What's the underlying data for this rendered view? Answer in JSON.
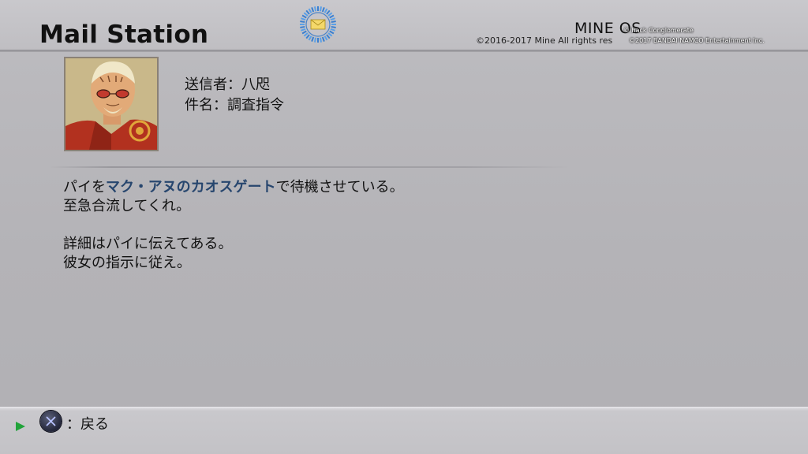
{
  "header": {
    "title": "Mail Station",
    "os_name": "MINE OS",
    "copyright_mine": "©2016-2017 Mine All rights res",
    "copyright_hack": "©.hack Conglomerate",
    "copyright_bandai": "©2017 BANDAI NAMCO Entertainment Inc.",
    "emblem_icon": "mail-envelope-icon"
  },
  "message": {
    "avatar_icon": "sender-portrait",
    "sender_label": "送信者",
    "sender_separator": "：",
    "sender_name": "八咫",
    "subject_label": "件名",
    "subject_separator": "：",
    "subject_text": "調査指令",
    "body": {
      "line1_pre": "パイを",
      "line1_highlight": "マク・アヌのカオスゲート",
      "line1_post": "で待機させている。",
      "line2": "至急合流してくれ。",
      "line3": "詳細はパイに伝えてある。",
      "line4": "彼女の指示に従え。"
    },
    "highlight_color": "#27466e"
  },
  "footer": {
    "indicator_icon": "play-arrow-icon",
    "button_icon": "cross-button-icon",
    "back_label": "：戻る"
  }
}
